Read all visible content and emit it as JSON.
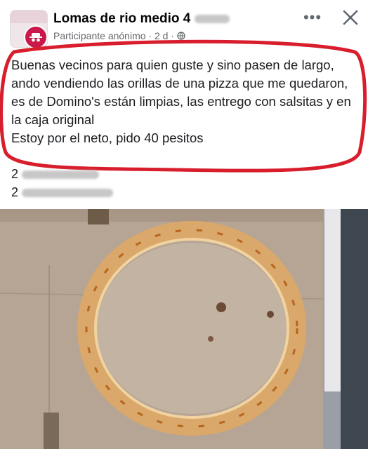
{
  "header": {
    "group_name": "Lomas de rio medio 4",
    "author": "Participante anónimo",
    "time": "2 d",
    "separator": "·",
    "more_label": "•••"
  },
  "post": {
    "body": "Buenas vecinos para quien guste y sino pasen de largo, ando vendiendo las orillas de una pizza que me quedaron, es de Domino's están limpias, las entrego con salsitas y en la caja original\nEstoy por el neto, pido 40 pesitos",
    "phone_1_prefix": "2",
    "phone_2_prefix": "2"
  },
  "colors": {
    "highlight": "#d81e2c",
    "cardboard": "#b9a99a",
    "crust": "#d9a86a"
  },
  "icons": [
    "anonymous-icon",
    "globe-icon",
    "more-icon",
    "close-icon"
  ]
}
